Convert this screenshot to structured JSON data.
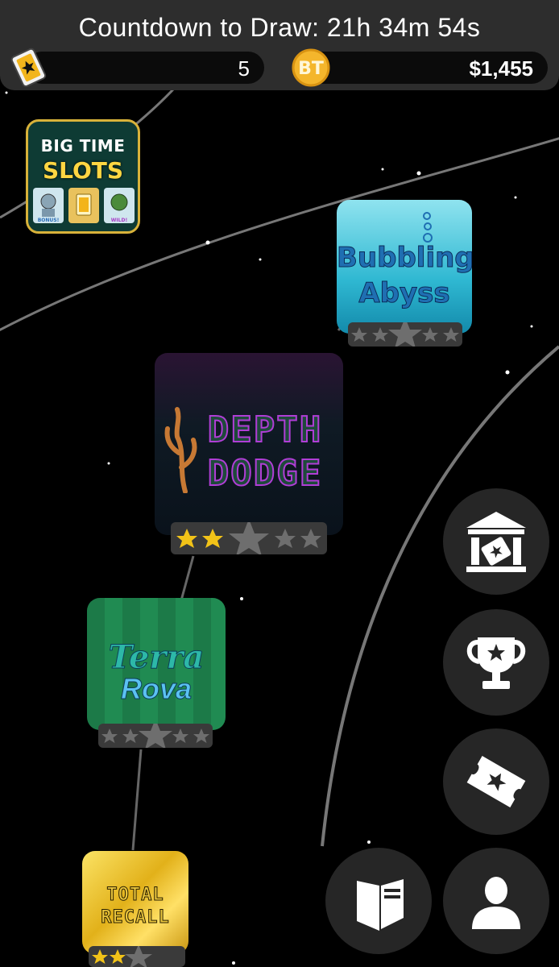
{
  "header": {
    "countdown_text": "Countdown to Draw: 21h 34m 54s",
    "tickets": "5",
    "cash": "$1,455",
    "ticket_icon": "ticket-icon",
    "coin_icon": "bt-coin-icon",
    "coin_letters": "BT"
  },
  "games": [
    {
      "id": "big-time-slots",
      "title_line1": "BIG TIME",
      "title_line2": "SLOTS",
      "reel_labels": [
        "BONUS!",
        "",
        "WILD!"
      ]
    },
    {
      "id": "bubbling-abyss",
      "title_line1": "Bubbling",
      "title_line2": "Abyss",
      "stars": 0
    },
    {
      "id": "depth-dodge",
      "title_line1": "DEPTH",
      "title_line2": "DODGE",
      "stars": 2
    },
    {
      "id": "terra-rova",
      "title_line1": "Terra",
      "title_line2": "Rova",
      "stars": 0
    },
    {
      "id": "total-recall",
      "title_line1": "TOTAL",
      "title_line2": "RECALL",
      "stars": 2
    }
  ],
  "nav_buttons": [
    {
      "name": "museum-button",
      "icon": "museum-ticket-icon"
    },
    {
      "name": "trophy-button",
      "icon": "trophy-icon"
    },
    {
      "name": "tickets-button",
      "icon": "ticket-star-icon"
    },
    {
      "name": "news-button",
      "icon": "newspaper-icon"
    },
    {
      "name": "profile-button",
      "icon": "person-icon"
    }
  ],
  "colors": {
    "header_bg": "#2d2d2d",
    "star_filled": "#f2c318",
    "star_empty": "#6e6e6e",
    "button_bg": "#262626"
  }
}
